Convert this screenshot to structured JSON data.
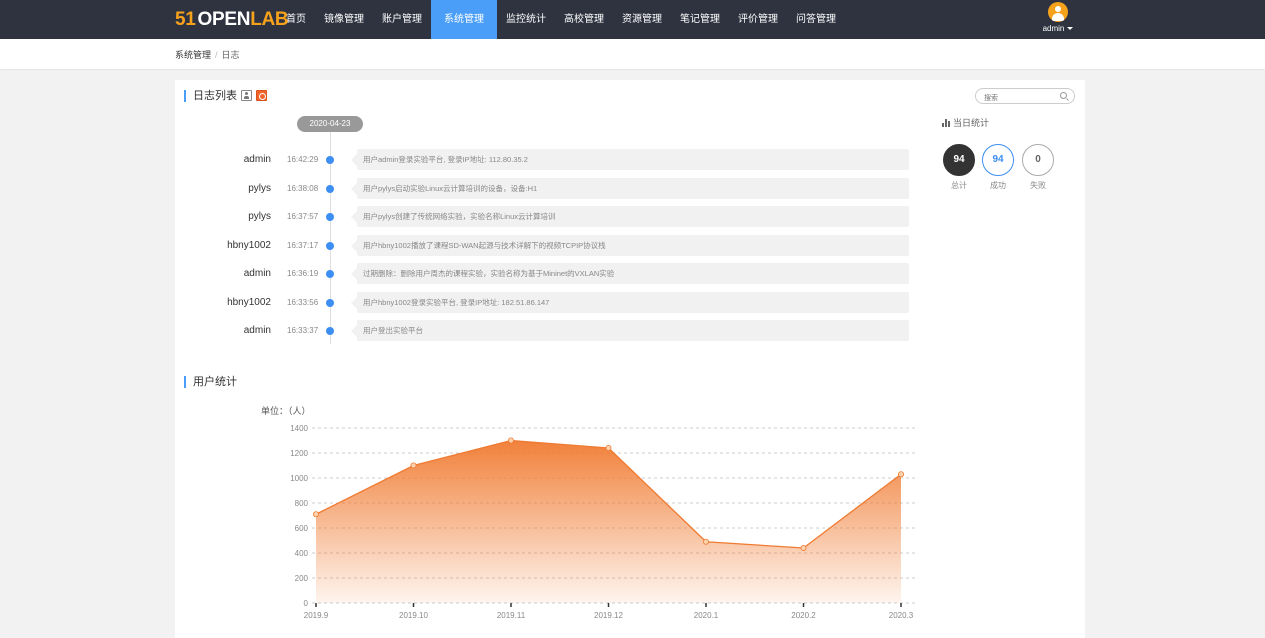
{
  "header": {
    "logo": {
      "num": "51",
      "open": "OPEN",
      "lab": "LAB"
    },
    "nav": [
      {
        "label": "首页",
        "active": false
      },
      {
        "label": "镜像管理",
        "active": false
      },
      {
        "label": "账户管理",
        "active": false
      },
      {
        "label": "系统管理",
        "active": true
      },
      {
        "label": "监控统计",
        "active": false
      },
      {
        "label": "高校管理",
        "active": false
      },
      {
        "label": "资源管理",
        "active": false
      },
      {
        "label": "笔记管理",
        "active": false
      },
      {
        "label": "评价管理",
        "active": false
      },
      {
        "label": "问答管理",
        "active": false
      }
    ],
    "user": "admin"
  },
  "breadcrumb": {
    "parent": "系统管理",
    "sep": "/",
    "current": "日志"
  },
  "log": {
    "title": "日志列表",
    "search_placeholder": "搜索",
    "date": "2020-04-23",
    "items": [
      {
        "user": "admin",
        "time": "16:42:29",
        "message": "用户admin登录实验平台, 登录IP地址: 112.80.35.2"
      },
      {
        "user": "pylys",
        "time": "16:38:08",
        "message": "用户pylys启动实验Linux云计算培训的设备，设备:H1"
      },
      {
        "user": "pylys",
        "time": "16:37:57",
        "message": "用户pylys创建了传统网络实验，实验名称Linux云计算培训"
      },
      {
        "user": "hbny1002",
        "time": "16:37:17",
        "message": "用户hbny1002播放了课程SD-WAN起源与技术详解下的视频TCPIP协议栈"
      },
      {
        "user": "admin",
        "time": "16:36:19",
        "message": "过期删除：删除用户周杰的课程实验，实验名称为基于Mininet的VXLAN实验"
      },
      {
        "user": "hbny1002",
        "time": "16:33:56",
        "message": "用户hbny1002登录实验平台, 登录IP地址: 182.51.86.147"
      },
      {
        "user": "admin",
        "time": "16:33:37",
        "message": "用户登出实验平台"
      }
    ]
  },
  "daily_stats": {
    "title": "当日统计",
    "total": {
      "value": "94",
      "label": "总计"
    },
    "success": {
      "value": "94",
      "label": "成功"
    },
    "fail": {
      "value": "0",
      "label": "失败"
    }
  },
  "user_stats": {
    "title": "用户统计",
    "unit": "单位：（人）"
  },
  "chart_data": {
    "type": "area",
    "title": "",
    "xlabel": "",
    "ylabel": "",
    "categories": [
      "2019.9",
      "2019.10",
      "2019.11",
      "2019.12",
      "2020.1",
      "2020.2",
      "2020.3"
    ],
    "values": [
      710,
      1100,
      1300,
      1240,
      490,
      440,
      1030
    ],
    "ylim": [
      0,
      1400
    ],
    "yticks": [
      0,
      200,
      400,
      600,
      800,
      1000,
      1200,
      1400
    ],
    "grid": true,
    "color": "#f07a30"
  }
}
